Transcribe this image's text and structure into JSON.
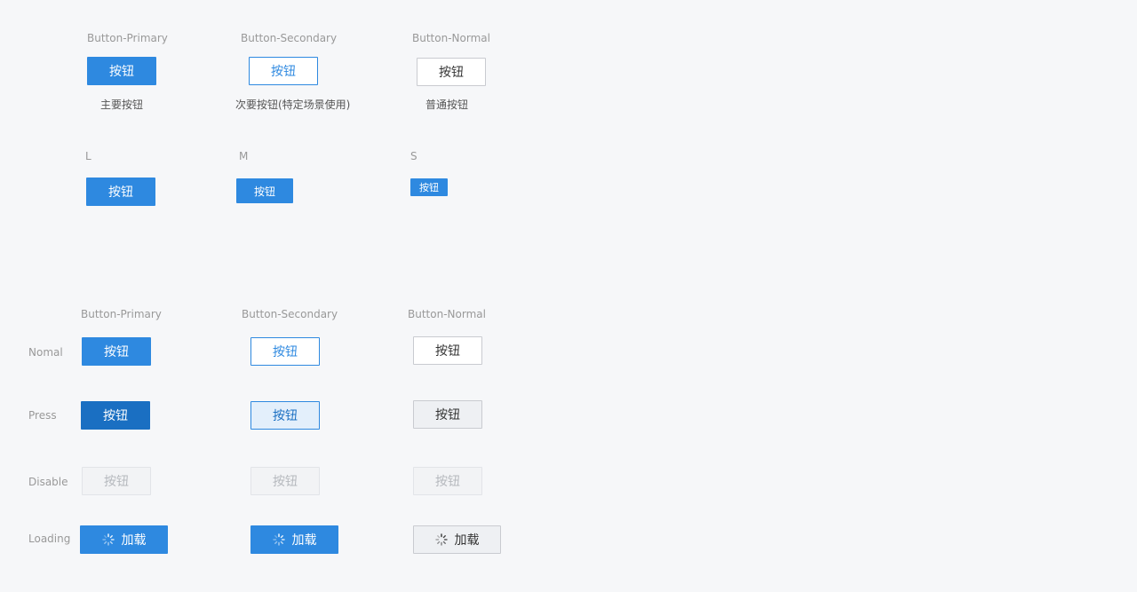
{
  "colors": {
    "primary": "#2e89e0",
    "primary_press": "#1a6fc2",
    "secondary_press_bg": "#e3effb",
    "normal_border": "#c9cbd0",
    "disabled_bg": "#f2f3f5",
    "disabled_text": "#b5b8bd",
    "background": "#f6f7f9"
  },
  "icons": {
    "loading": "spinner-icon"
  },
  "types": {
    "primary_label": "Button-Primary",
    "secondary_label": "Button-Secondary",
    "normal_label": "Button-Normal",
    "button_text": "按钮",
    "primary_desc": "主要按钮",
    "secondary_desc": "次要按钮(特定场景使用)",
    "normal_desc": "普通按钮"
  },
  "sizes": {
    "large_label": "L",
    "medium_label": "M",
    "small_label": "S",
    "button_text": "按钮"
  },
  "states": {
    "primary_label": "Button-Primary",
    "secondary_label": "Button-Secondary",
    "normal_label": "Button-Normal",
    "normal_row": "Nomal",
    "press_row": "Press",
    "disable_row": "Disable",
    "loading_row": "Loading",
    "button_text": "按钮",
    "loading_text": "加载"
  }
}
